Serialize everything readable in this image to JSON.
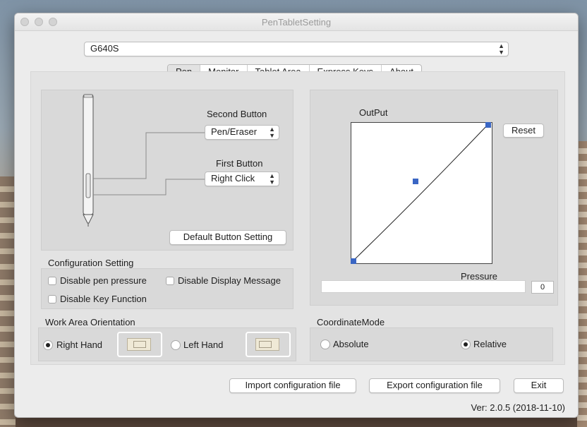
{
  "window": {
    "title": "PenTabletSetting",
    "device_select": "G640S"
  },
  "tabs": [
    {
      "label": "Pen",
      "active": true
    },
    {
      "label": "Monitor",
      "active": false
    },
    {
      "label": "Tablet Area",
      "active": false
    },
    {
      "label": "Express Keys",
      "active": false
    },
    {
      "label": "About",
      "active": false
    }
  ],
  "pen": {
    "second_button_label": "Second Button",
    "second_button_value": "Pen/Eraser",
    "first_button_label": "First Button",
    "first_button_value": "Right Click",
    "default_button_label": "Default  Button Setting"
  },
  "config": {
    "title": "Configuration Setting",
    "disable_pen_pressure": "Disable pen pressure",
    "disable_display_message": "Disable Display Message",
    "disable_key_function": "Disable Key Function"
  },
  "orientation": {
    "title": "Work Area Orientation",
    "right_hand": "Right Hand",
    "left_hand": "Left Hand",
    "selected": "Right Hand"
  },
  "output": {
    "title": "OutPut",
    "reset_label": "Reset",
    "pressure_label": "Pressure",
    "pressure_value": "0"
  },
  "coordinate": {
    "title": "CoordinateMode",
    "absolute": "Absolute",
    "relative": "Relative",
    "selected": "Relative"
  },
  "footer": {
    "import_label": "Import configuration file",
    "export_label": "Export configuration file",
    "exit_label": "Exit",
    "version": "Ver: 2.0.5 (2018-11-10)"
  },
  "colors": {
    "curve_handle": "#3a66c4"
  }
}
